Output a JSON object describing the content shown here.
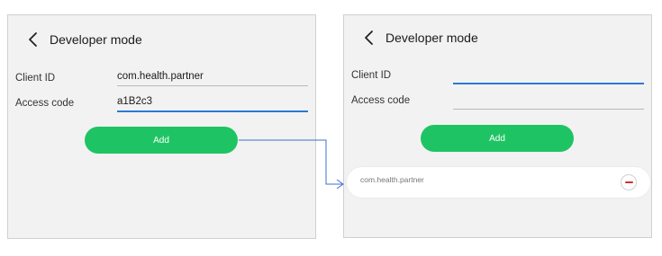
{
  "left_screen": {
    "title": "Developer mode",
    "client_id": {
      "label": "Client ID",
      "value": "com.health.partner"
    },
    "access_code": {
      "label": "Access code",
      "value": "a1B2c3"
    },
    "add_label": "Add"
  },
  "right_screen": {
    "title": "Developer mode",
    "client_id": {
      "label": "Client ID",
      "value": ""
    },
    "access_code": {
      "label": "Access code",
      "value": ""
    },
    "add_label": "Add",
    "partners": [
      {
        "client_id": "com.health.partner"
      }
    ]
  },
  "colors": {
    "accent_green": "#1ec463",
    "focus_blue": "#2a7ad6",
    "remove_red": "#d32f2f",
    "screen_bg": "#f2f2f2"
  },
  "icons": {
    "back": "chevron-left-icon",
    "remove": "minus-circle-icon"
  }
}
